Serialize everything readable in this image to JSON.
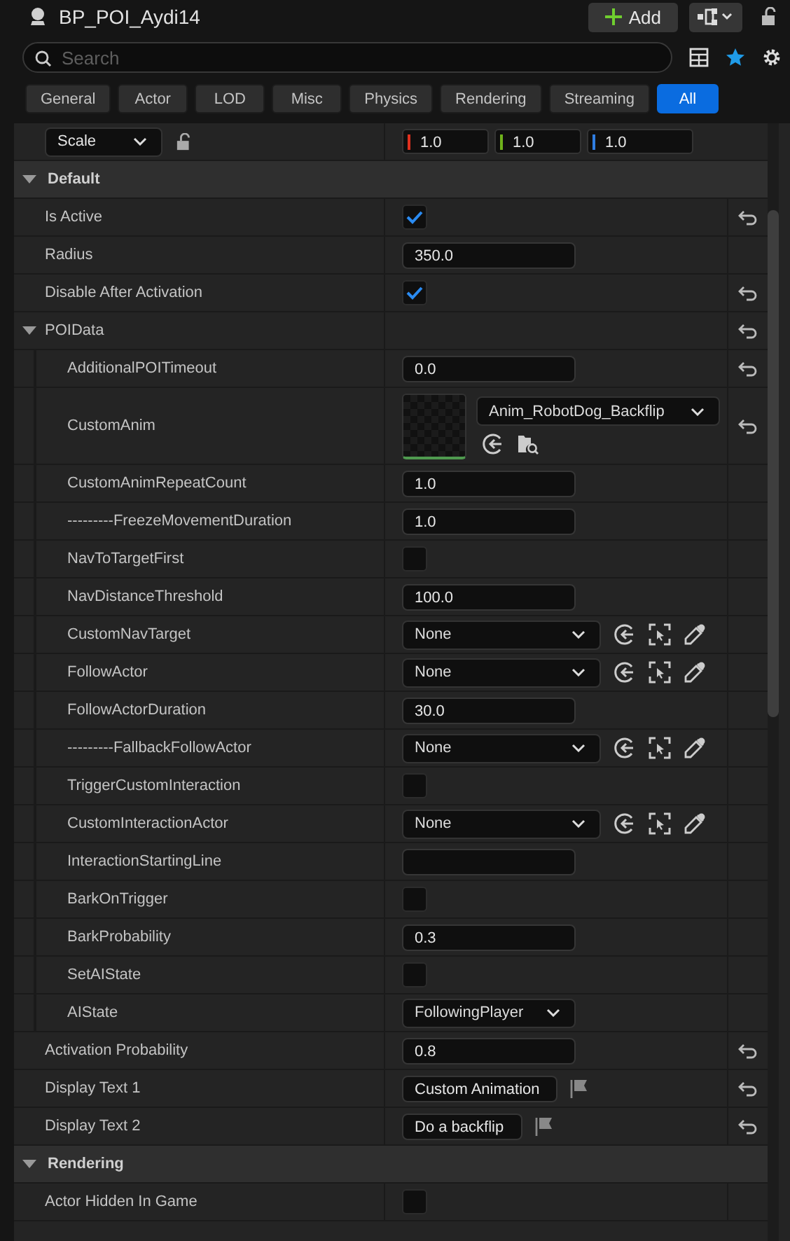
{
  "header": {
    "title": "BP_POI_Aydi14",
    "add_button": "Add"
  },
  "search": {
    "placeholder": "Search"
  },
  "filters": [
    {
      "label": "General",
      "selected": false
    },
    {
      "label": "Actor",
      "selected": false
    },
    {
      "label": "LOD",
      "selected": false
    },
    {
      "label": "Misc",
      "selected": false
    },
    {
      "label": "Physics",
      "selected": false
    },
    {
      "label": "Rendering",
      "selected": false
    },
    {
      "label": "Streaming",
      "selected": false
    },
    {
      "label": "All",
      "selected": true
    }
  ],
  "transform": {
    "mode": "Scale",
    "values": [
      {
        "value": "1.0",
        "color": "#e0301e"
      },
      {
        "value": "1.0",
        "color": "#6fb21b"
      },
      {
        "value": "1.0",
        "color": "#2f7de1"
      }
    ]
  },
  "sections": [
    {
      "title": "Default",
      "expanded": true,
      "rows": [
        {
          "label": "Is Active",
          "kind": "checkbox",
          "checked": true,
          "resettable": true
        },
        {
          "label": "Radius",
          "kind": "number",
          "value": "350.0",
          "resettable": false
        },
        {
          "label": "Disable After Activation",
          "kind": "checkbox",
          "checked": true,
          "resettable": true
        },
        {
          "label": "POIData",
          "kind": "group",
          "expanded": true,
          "resettable": true,
          "children": [
            {
              "label": "AdditionalPOITimeout",
              "kind": "number",
              "value": "0.0",
              "resettable": true
            },
            {
              "label": "CustomAnim",
              "kind": "asset",
              "value": "Anim_RobotDog_Backflip",
              "resettable": true
            },
            {
              "label": "CustomAnimRepeatCount",
              "kind": "number",
              "value": "1.0",
              "resettable": false
            },
            {
              "label": "---------FreezeMovementDuration",
              "kind": "number",
              "value": "1.0",
              "resettable": false
            },
            {
              "label": "NavToTargetFirst",
              "kind": "checkbox",
              "checked": false,
              "resettable": false
            },
            {
              "label": "NavDistanceThreshold",
              "kind": "number",
              "value": "100.0",
              "resettable": false
            },
            {
              "label": "CustomNavTarget",
              "kind": "object",
              "value": "None",
              "resettable": false
            },
            {
              "label": "FollowActor",
              "kind": "object",
              "value": "None",
              "resettable": false
            },
            {
              "label": "FollowActorDuration",
              "kind": "number",
              "value": "30.0",
              "resettable": false
            },
            {
              "label": "---------FallbackFollowActor",
              "kind": "object",
              "value": "None",
              "resettable": false
            },
            {
              "label": "TriggerCustomInteraction",
              "kind": "checkbox",
              "checked": false,
              "resettable": false
            },
            {
              "label": "CustomInteractionActor",
              "kind": "object",
              "value": "None",
              "resettable": false
            },
            {
              "label": "InteractionStartingLine",
              "kind": "number",
              "resettable": false
            },
            {
              "label": "BarkOnTrigger",
              "kind": "checkbox",
              "checked": false,
              "resettable": false
            },
            {
              "label": "BarkProbability",
              "kind": "number",
              "value": "0.3",
              "resettable": false
            },
            {
              "label": "SetAIState",
              "kind": "checkbox",
              "checked": false,
              "resettable": false
            },
            {
              "label": "AIState",
              "kind": "enum",
              "value": "FollowingPlayer",
              "resettable": false
            }
          ]
        },
        {
          "label": "Activation Probability",
          "kind": "number",
          "value": "0.8",
          "resettable": true
        },
        {
          "label": "Display Text 1",
          "kind": "text",
          "value": "Custom Animation",
          "resettable": true
        },
        {
          "label": "Display Text 2",
          "kind": "text",
          "value": "Do a backflip",
          "resettable": true
        }
      ]
    },
    {
      "title": "Rendering",
      "expanded": true,
      "rows": [
        {
          "label": "Actor Hidden In Game",
          "kind": "checkbox",
          "checked": false,
          "resettable": false
        }
      ]
    }
  ]
}
